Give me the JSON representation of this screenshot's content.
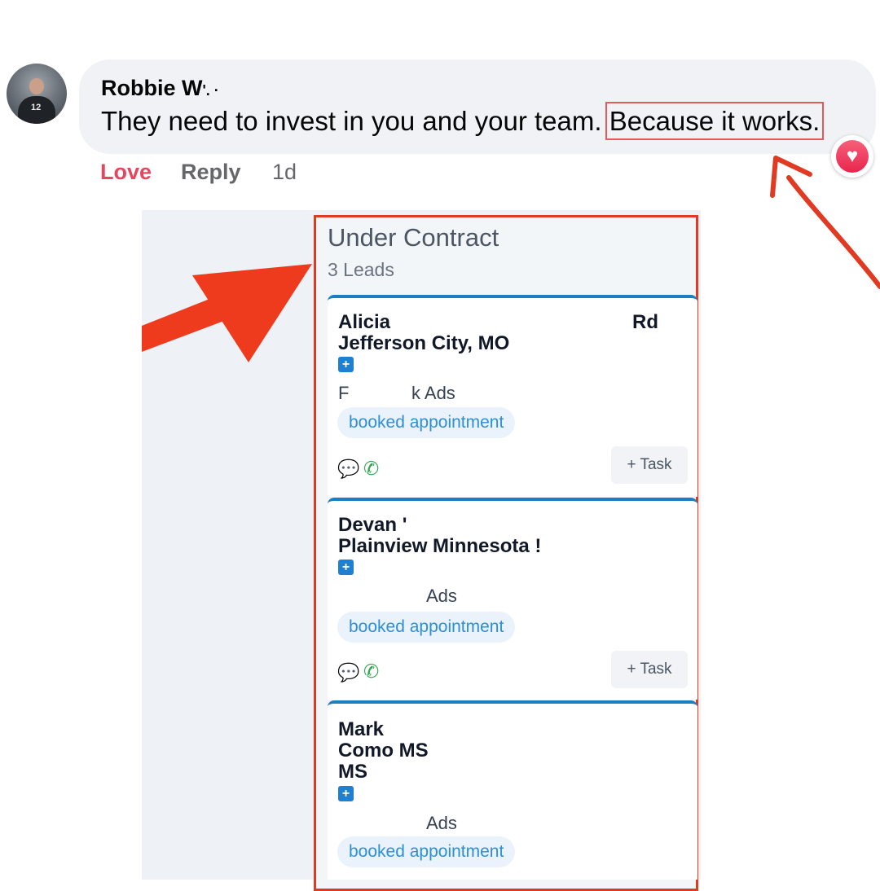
{
  "comment": {
    "author": "Robbie W",
    "author_trail": "'. ·",
    "text_before": "They need to invest in you and your team. ",
    "text_highlight": "Because it works.",
    "reaction_icon": "heart-icon",
    "actions": {
      "love": "Love",
      "reply": "Reply",
      "time": "1d"
    }
  },
  "crm": {
    "column_title": "Under Contract",
    "column_count": "3 Leads",
    "cards": [
      {
        "name": "Alicia",
        "address_suffix": "Rd",
        "location": "Jefferson City, MO",
        "source_prefix": "F",
        "source": "k Ads",
        "tag": "booked appointment",
        "task_label": "+ Task"
      },
      {
        "name": "Devan '",
        "location": "Plainview Minnesota !",
        "source": "Ads",
        "tag": "booked appointment",
        "task_label": "+ Task"
      },
      {
        "name": "Mark",
        "location": "Como MS",
        "location2": "MS",
        "source": "Ads",
        "tag": "booked appointment"
      }
    ]
  },
  "colors": {
    "highlight_box": "#e03a23",
    "card_accent": "#1b7fc0",
    "tag_text": "#2e8fd6",
    "love": "#e4465f"
  }
}
